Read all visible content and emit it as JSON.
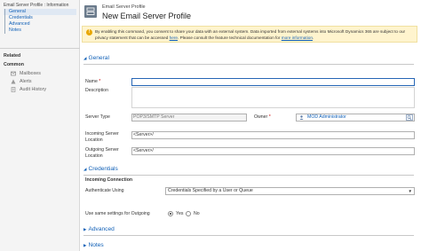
{
  "nav": {
    "breadcrumb": "Email Server Profile : Information",
    "links": [
      "General",
      "Credentials",
      "Advanced",
      "Notes"
    ],
    "related_label": "Related",
    "common_label": "Common",
    "common_items": [
      "Mailboxes",
      "Alerts",
      "Audit History"
    ]
  },
  "header": {
    "entity": "Email Server Profile",
    "title": "New Email Server Profile"
  },
  "banner": {
    "text_before": "By enabling this command, you consent to share your data with an external system. Data imported from external systems into Microsoft Dynamics 365 are subject to our privacy statement that can be accessed ",
    "link1": "here",
    "text_middle": ". Please consult the feature technical documentation for ",
    "link2": "more information",
    "text_after": "."
  },
  "sections": {
    "general": "General",
    "credentials": "Credentials",
    "advanced": "Advanced",
    "notes": "Notes"
  },
  "general": {
    "name_label": "Name",
    "description_label": "Description",
    "server_type_label": "Server Type",
    "server_type_value": "POP3/SMTP Server",
    "owner_label": "Owner",
    "owner_value": "MOD Administrator",
    "incoming_label_1": "Incoming Server",
    "incoming_label_2": "Location",
    "incoming_value": "<Server>/",
    "outgoing_label_1": "Outgoing Server",
    "outgoing_label_2": "Location",
    "outgoing_value": "<Server>/"
  },
  "credentials": {
    "incoming_heading": "Incoming Connection",
    "auth_label": "Authenticate Using",
    "auth_value": "Credentials Specified by a User or Queue",
    "same_settings_label": "Use same settings for Outgoing",
    "yes_label": "Yes",
    "no_label": "No",
    "selected": "Yes"
  },
  "colors": {
    "link": "#1160b7",
    "banner_bg": "#fff4ce",
    "warning_icon": "#e8a700",
    "required": "#cc0000"
  }
}
